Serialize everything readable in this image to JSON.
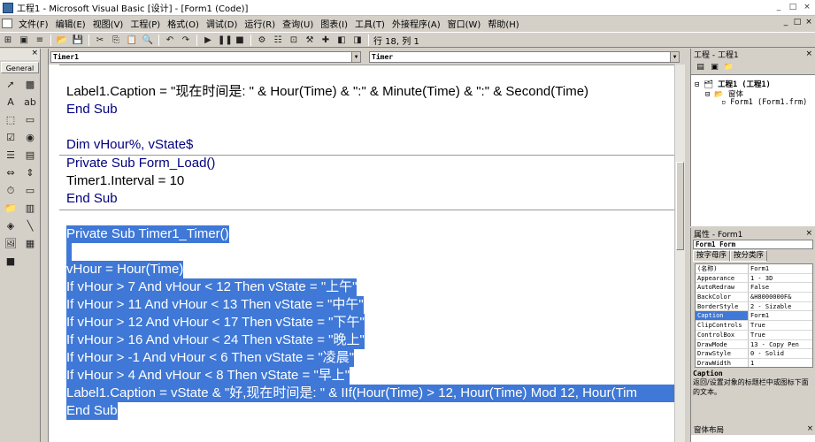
{
  "window": {
    "title": "工程1 - Microsoft Visual Basic [设计] - [Form1 (Code)]",
    "controls": [
      "_",
      "□",
      "×"
    ],
    "mdi_controls": [
      "_",
      "□",
      "×"
    ]
  },
  "menu": [
    "文件(F)",
    "编辑(E)",
    "视图(V)",
    "工程(P)",
    "格式(O)",
    "调试(D)",
    "运行(R)",
    "查询(U)",
    "图表(I)",
    "工具(T)",
    "外接程序(A)",
    "窗口(W)",
    "帮助(H)"
  ],
  "toolbar": {
    "position": "行 18, 列 1"
  },
  "toolbox": {
    "close": "×",
    "tab": "General"
  },
  "code": {
    "object_combo": "Timer1",
    "proc_combo": "Timer",
    "lines": [
      "Label1.Caption = \"现在时间是: \" & Hour(Time) & \":\" & Minute(Time) & \":\" & Second(Time)",
      "End Sub",
      "",
      "Dim vHour%, vState$",
      "Private Sub Form_Load()",
      "Timer1.Interval = 10",
      "End Sub",
      "",
      "Private Sub Timer1_Timer()",
      "",
      "vHour = Hour(Time)",
      "If vHour > 7 And vHour < 12 Then vState = \"上午\"",
      "If vHour > 11 And vHour < 13 Then vState = \"中午\"",
      "If vHour > 12 And vHour < 17 Then vState = \"下午\"",
      "If vHour > 16 And vHour < 24 Then vState = \"晚上\"",
      "If vHour > -1 And vHour < 6 Then vState = \"凌晨\"",
      "If vHour > 4 And vHour < 8 Then vState = \"早上\"",
      "Label1.Caption = vState & \"好,现在时间是: \" & IIf(Hour(Time) > 12, Hour(Time) Mod 12, Hour(Tim",
      "End Sub"
    ]
  },
  "project": {
    "title": "工程 - 工程1",
    "close": "×",
    "tree": [
      "工程1 (工程1)",
      "窗体",
      "Form1 (Form1.frm)"
    ]
  },
  "properties": {
    "title": "属性 - Form1",
    "close": "×",
    "object": "Form1  Form",
    "tabs": [
      "按字母序",
      "按分类序"
    ],
    "rows": [
      {
        "name": "(名称)",
        "value": "Form1"
      },
      {
        "name": "Appearance",
        "value": "1 - 3D"
      },
      {
        "name": "AutoRedraw",
        "value": "False"
      },
      {
        "name": "BackColor",
        "value": "&H8000000F&"
      },
      {
        "name": "BorderStyle",
        "value": "2 - Sizable"
      },
      {
        "name": "Caption",
        "value": "Form1"
      },
      {
        "name": "ClipControls",
        "value": "True"
      },
      {
        "name": "ControlBox",
        "value": "True"
      },
      {
        "name": "DrawMode",
        "value": "13 - Copy Pen"
      },
      {
        "name": "DrawStyle",
        "value": "0 - Solid"
      },
      {
        "name": "DrawWidth",
        "value": "1"
      }
    ],
    "desc_title": "Caption",
    "desc_text": "返回/设置对象的标题栏中或图标下面的文本。"
  },
  "layout": {
    "title": "窗体布局",
    "close": "×"
  }
}
